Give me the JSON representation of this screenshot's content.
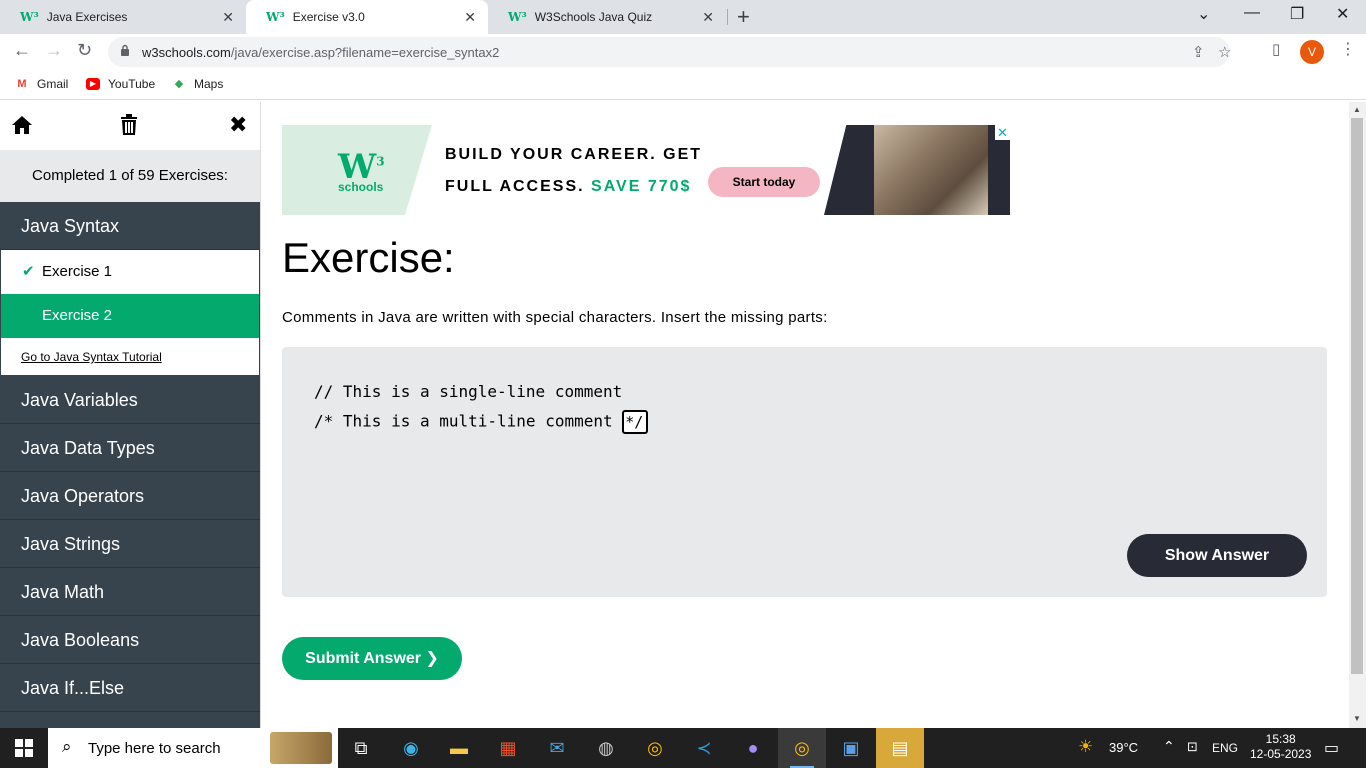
{
  "browser": {
    "tabs": [
      {
        "title": "Java Exercises",
        "favicon": "W³"
      },
      {
        "title": "Exercise v3.0",
        "favicon": "W³"
      },
      {
        "title": "W3Schools Java Quiz",
        "favicon": "W³"
      }
    ],
    "url_host": "w3schools.com",
    "url_path": "/java/exercise.asp?filename=exercise_syntax2",
    "profile_initial": "V",
    "bookmarks": [
      {
        "label": "Gmail"
      },
      {
        "label": "YouTube"
      },
      {
        "label": "Maps"
      }
    ]
  },
  "sidebar": {
    "progress_text": "Completed 1 of 59 Exercises:",
    "active_category": "Java Syntax",
    "exercises": [
      {
        "label": "Exercise 1",
        "completed": true
      },
      {
        "label": "Exercise 2",
        "completed": false,
        "active": true
      }
    ],
    "tutorial_link": "Go to Java Syntax Tutorial",
    "categories": [
      "Java Variables",
      "Java Data Types",
      "Java Operators",
      "Java Strings",
      "Java Math",
      "Java Booleans",
      "Java If...Else"
    ]
  },
  "ad": {
    "logo_text": "W",
    "logo_sup": "3",
    "logo_sub": "schools",
    "line1": "BUILD YOUR CAREER. GET",
    "line2_prefix": "FULL ACCESS.",
    "line2_highlight": "SAVE 770$",
    "cta": "Start today",
    "close": "✕"
  },
  "exercise": {
    "title": "Exercise:",
    "description": "Comments in Java are written with special characters. Insert the missing parts:",
    "code_line1": "// This is a single-line comment",
    "code_line2_prefix": "/* This is a multi-line comment ",
    "input_value": "*/",
    "show_answer": "Show Answer",
    "submit": "Submit Answer ❯"
  },
  "taskbar": {
    "search_placeholder": "Type here to search",
    "weather": "39°C",
    "language": "ENG",
    "time": "15:38",
    "date": "12-05-2023"
  },
  "colors": {
    "accent": "#04aa6d",
    "sidebar_dark": "#38444d",
    "button_dark": "#282a35",
    "code_bg": "#e7e9eb"
  }
}
